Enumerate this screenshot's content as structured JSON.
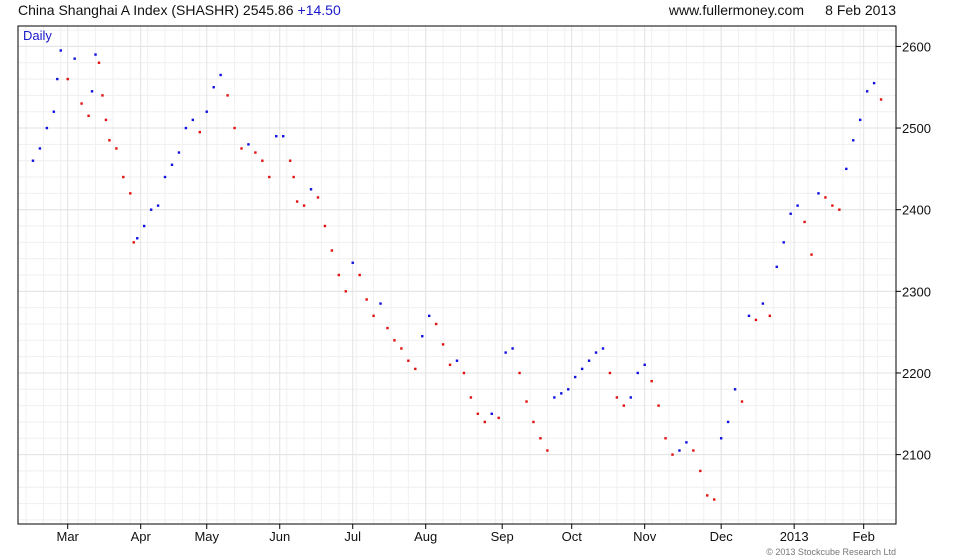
{
  "header": {
    "title": "China Shanghai A Index (SHASHR) 2545.86",
    "change": "+14.50",
    "site": "www.fullermoney.com",
    "date": "8 Feb 2013"
  },
  "footer": {
    "copyright": "© 2013 Stockcube Research Ltd"
  },
  "colors": {
    "up": "#1010e0",
    "down": "#e01010",
    "grid": "#e3e3e3",
    "frame": "#000000",
    "label_blue": "#1a1acc"
  },
  "chart_data": {
    "type": "ohlc",
    "period_label": "Daily",
    "ylim": [
      2015,
      2625
    ],
    "y_ticks": [
      2100,
      2200,
      2300,
      2400,
      2500,
      2600
    ],
    "x_range": [
      0,
      248
    ],
    "x_ticks": [
      {
        "label": "Mar",
        "x": 12
      },
      {
        "label": "Apr",
        "x": 33
      },
      {
        "label": "May",
        "x": 52
      },
      {
        "label": "Jun",
        "x": 73
      },
      {
        "label": "Jul",
        "x": 94
      },
      {
        "label": "Aug",
        "x": 115
      },
      {
        "label": "Sep",
        "x": 137
      },
      {
        "label": "Oct",
        "x": 157
      },
      {
        "label": "Nov",
        "x": 178
      },
      {
        "label": "Dec",
        "x": 200
      },
      {
        "label": "2013",
        "x": 221
      },
      {
        "label": "Feb",
        "x": 241
      }
    ],
    "series": [
      {
        "values": [
          [
            2,
            2460
          ],
          [
            4,
            2475
          ],
          [
            6,
            2500
          ],
          [
            8,
            2520
          ],
          [
            9,
            2560
          ],
          [
            10,
            2595
          ],
          [
            12,
            2560
          ],
          [
            14,
            2585
          ],
          [
            16,
            2530
          ],
          [
            18,
            2515
          ],
          [
            19,
            2545
          ],
          [
            20,
            2590
          ],
          [
            21,
            2580
          ],
          [
            22,
            2540
          ],
          [
            23,
            2510
          ],
          [
            24,
            2485
          ],
          [
            26,
            2475
          ],
          [
            28,
            2440
          ],
          [
            30,
            2420
          ],
          [
            31,
            2360
          ],
          [
            32,
            2365
          ],
          [
            34,
            2380
          ],
          [
            36,
            2400
          ],
          [
            38,
            2405
          ],
          [
            40,
            2440
          ],
          [
            42,
            2455
          ],
          [
            44,
            2470
          ],
          [
            46,
            2500
          ],
          [
            48,
            2510
          ],
          [
            50,
            2495
          ],
          [
            52,
            2520
          ],
          [
            54,
            2550
          ],
          [
            56,
            2565
          ],
          [
            58,
            2540
          ],
          [
            60,
            2500
          ],
          [
            62,
            2475
          ],
          [
            64,
            2480
          ],
          [
            66,
            2470
          ],
          [
            68,
            2460
          ],
          [
            70,
            2440
          ],
          [
            72,
            2490
          ],
          [
            74,
            2490
          ],
          [
            76,
            2460
          ],
          [
            77,
            2440
          ],
          [
            78,
            2410
          ],
          [
            80,
            2405
          ],
          [
            82,
            2425
          ],
          [
            84,
            2415
          ],
          [
            86,
            2380
          ],
          [
            88,
            2350
          ],
          [
            90,
            2320
          ],
          [
            92,
            2300
          ],
          [
            94,
            2335
          ],
          [
            96,
            2320
          ],
          [
            98,
            2290
          ],
          [
            100,
            2270
          ],
          [
            102,
            2285
          ],
          [
            104,
            2255
          ],
          [
            106,
            2240
          ],
          [
            108,
            2230
          ],
          [
            110,
            2215
          ],
          [
            112,
            2205
          ],
          [
            114,
            2245
          ],
          [
            116,
            2270
          ],
          [
            118,
            2260
          ],
          [
            120,
            2235
          ],
          [
            122,
            2210
          ],
          [
            124,
            2215
          ],
          [
            126,
            2200
          ],
          [
            128,
            2170
          ],
          [
            130,
            2150
          ],
          [
            132,
            2140
          ],
          [
            134,
            2150
          ],
          [
            136,
            2145
          ],
          [
            138,
            2225
          ],
          [
            140,
            2230
          ],
          [
            142,
            2200
          ],
          [
            144,
            2165
          ],
          [
            146,
            2140
          ],
          [
            148,
            2120
          ],
          [
            150,
            2105
          ],
          [
            152,
            2170
          ],
          [
            154,
            2175
          ],
          [
            156,
            2180
          ],
          [
            158,
            2195
          ],
          [
            160,
            2205
          ],
          [
            162,
            2215
          ],
          [
            164,
            2225
          ],
          [
            166,
            2230
          ],
          [
            168,
            2200
          ],
          [
            170,
            2170
          ],
          [
            172,
            2160
          ],
          [
            174,
            2170
          ],
          [
            176,
            2200
          ],
          [
            178,
            2210
          ],
          [
            180,
            2190
          ],
          [
            182,
            2160
          ],
          [
            184,
            2120
          ],
          [
            186,
            2100
          ],
          [
            188,
            2105
          ],
          [
            190,
            2115
          ],
          [
            192,
            2105
          ],
          [
            194,
            2080
          ],
          [
            196,
            2050
          ],
          [
            198,
            2045
          ],
          [
            200,
            2120
          ],
          [
            202,
            2140
          ],
          [
            204,
            2180
          ],
          [
            206,
            2165
          ],
          [
            208,
            2270
          ],
          [
            210,
            2265
          ],
          [
            212,
            2285
          ],
          [
            214,
            2270
          ],
          [
            216,
            2330
          ],
          [
            218,
            2360
          ],
          [
            220,
            2395
          ],
          [
            222,
            2405
          ],
          [
            224,
            2385
          ],
          [
            226,
            2345
          ],
          [
            228,
            2420
          ],
          [
            230,
            2415
          ],
          [
            232,
            2405
          ],
          [
            234,
            2400
          ],
          [
            236,
            2450
          ],
          [
            238,
            2485
          ],
          [
            240,
            2510
          ],
          [
            242,
            2545
          ],
          [
            244,
            2555
          ],
          [
            246,
            2535
          ]
        ]
      }
    ]
  }
}
